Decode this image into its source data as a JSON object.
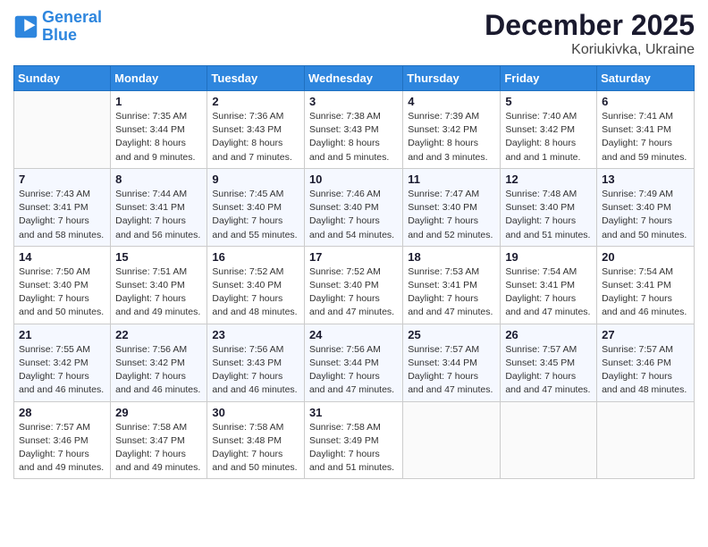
{
  "logo": {
    "line1": "General",
    "line2": "Blue"
  },
  "title": "December 2025",
  "location": "Koriukivka, Ukraine",
  "weekdays": [
    "Sunday",
    "Monday",
    "Tuesday",
    "Wednesday",
    "Thursday",
    "Friday",
    "Saturday"
  ],
  "weeks": [
    [
      {
        "day": "",
        "sunrise": "",
        "sunset": "",
        "daylight": ""
      },
      {
        "day": "1",
        "sunrise": "Sunrise: 7:35 AM",
        "sunset": "Sunset: 3:44 PM",
        "daylight": "Daylight: 8 hours and 9 minutes."
      },
      {
        "day": "2",
        "sunrise": "Sunrise: 7:36 AM",
        "sunset": "Sunset: 3:43 PM",
        "daylight": "Daylight: 8 hours and 7 minutes."
      },
      {
        "day": "3",
        "sunrise": "Sunrise: 7:38 AM",
        "sunset": "Sunset: 3:43 PM",
        "daylight": "Daylight: 8 hours and 5 minutes."
      },
      {
        "day": "4",
        "sunrise": "Sunrise: 7:39 AM",
        "sunset": "Sunset: 3:42 PM",
        "daylight": "Daylight: 8 hours and 3 minutes."
      },
      {
        "day": "5",
        "sunrise": "Sunrise: 7:40 AM",
        "sunset": "Sunset: 3:42 PM",
        "daylight": "Daylight: 8 hours and 1 minute."
      },
      {
        "day": "6",
        "sunrise": "Sunrise: 7:41 AM",
        "sunset": "Sunset: 3:41 PM",
        "daylight": "Daylight: 7 hours and 59 minutes."
      }
    ],
    [
      {
        "day": "7",
        "sunrise": "Sunrise: 7:43 AM",
        "sunset": "Sunset: 3:41 PM",
        "daylight": "Daylight: 7 hours and 58 minutes."
      },
      {
        "day": "8",
        "sunrise": "Sunrise: 7:44 AM",
        "sunset": "Sunset: 3:41 PM",
        "daylight": "Daylight: 7 hours and 56 minutes."
      },
      {
        "day": "9",
        "sunrise": "Sunrise: 7:45 AM",
        "sunset": "Sunset: 3:40 PM",
        "daylight": "Daylight: 7 hours and 55 minutes."
      },
      {
        "day": "10",
        "sunrise": "Sunrise: 7:46 AM",
        "sunset": "Sunset: 3:40 PM",
        "daylight": "Daylight: 7 hours and 54 minutes."
      },
      {
        "day": "11",
        "sunrise": "Sunrise: 7:47 AM",
        "sunset": "Sunset: 3:40 PM",
        "daylight": "Daylight: 7 hours and 52 minutes."
      },
      {
        "day": "12",
        "sunrise": "Sunrise: 7:48 AM",
        "sunset": "Sunset: 3:40 PM",
        "daylight": "Daylight: 7 hours and 51 minutes."
      },
      {
        "day": "13",
        "sunrise": "Sunrise: 7:49 AM",
        "sunset": "Sunset: 3:40 PM",
        "daylight": "Daylight: 7 hours and 50 minutes."
      }
    ],
    [
      {
        "day": "14",
        "sunrise": "Sunrise: 7:50 AM",
        "sunset": "Sunset: 3:40 PM",
        "daylight": "Daylight: 7 hours and 50 minutes."
      },
      {
        "day": "15",
        "sunrise": "Sunrise: 7:51 AM",
        "sunset": "Sunset: 3:40 PM",
        "daylight": "Daylight: 7 hours and 49 minutes."
      },
      {
        "day": "16",
        "sunrise": "Sunrise: 7:52 AM",
        "sunset": "Sunset: 3:40 PM",
        "daylight": "Daylight: 7 hours and 48 minutes."
      },
      {
        "day": "17",
        "sunrise": "Sunrise: 7:52 AM",
        "sunset": "Sunset: 3:40 PM",
        "daylight": "Daylight: 7 hours and 47 minutes."
      },
      {
        "day": "18",
        "sunrise": "Sunrise: 7:53 AM",
        "sunset": "Sunset: 3:41 PM",
        "daylight": "Daylight: 7 hours and 47 minutes."
      },
      {
        "day": "19",
        "sunrise": "Sunrise: 7:54 AM",
        "sunset": "Sunset: 3:41 PM",
        "daylight": "Daylight: 7 hours and 47 minutes."
      },
      {
        "day": "20",
        "sunrise": "Sunrise: 7:54 AM",
        "sunset": "Sunset: 3:41 PM",
        "daylight": "Daylight: 7 hours and 46 minutes."
      }
    ],
    [
      {
        "day": "21",
        "sunrise": "Sunrise: 7:55 AM",
        "sunset": "Sunset: 3:42 PM",
        "daylight": "Daylight: 7 hours and 46 minutes."
      },
      {
        "day": "22",
        "sunrise": "Sunrise: 7:56 AM",
        "sunset": "Sunset: 3:42 PM",
        "daylight": "Daylight: 7 hours and 46 minutes."
      },
      {
        "day": "23",
        "sunrise": "Sunrise: 7:56 AM",
        "sunset": "Sunset: 3:43 PM",
        "daylight": "Daylight: 7 hours and 46 minutes."
      },
      {
        "day": "24",
        "sunrise": "Sunrise: 7:56 AM",
        "sunset": "Sunset: 3:44 PM",
        "daylight": "Daylight: 7 hours and 47 minutes."
      },
      {
        "day": "25",
        "sunrise": "Sunrise: 7:57 AM",
        "sunset": "Sunset: 3:44 PM",
        "daylight": "Daylight: 7 hours and 47 minutes."
      },
      {
        "day": "26",
        "sunrise": "Sunrise: 7:57 AM",
        "sunset": "Sunset: 3:45 PM",
        "daylight": "Daylight: 7 hours and 47 minutes."
      },
      {
        "day": "27",
        "sunrise": "Sunrise: 7:57 AM",
        "sunset": "Sunset: 3:46 PM",
        "daylight": "Daylight: 7 hours and 48 minutes."
      }
    ],
    [
      {
        "day": "28",
        "sunrise": "Sunrise: 7:57 AM",
        "sunset": "Sunset: 3:46 PM",
        "daylight": "Daylight: 7 hours and 49 minutes."
      },
      {
        "day": "29",
        "sunrise": "Sunrise: 7:58 AM",
        "sunset": "Sunset: 3:47 PM",
        "daylight": "Daylight: 7 hours and 49 minutes."
      },
      {
        "day": "30",
        "sunrise": "Sunrise: 7:58 AM",
        "sunset": "Sunset: 3:48 PM",
        "daylight": "Daylight: 7 hours and 50 minutes."
      },
      {
        "day": "31",
        "sunrise": "Sunrise: 7:58 AM",
        "sunset": "Sunset: 3:49 PM",
        "daylight": "Daylight: 7 hours and 51 minutes."
      },
      {
        "day": "",
        "sunrise": "",
        "sunset": "",
        "daylight": ""
      },
      {
        "day": "",
        "sunrise": "",
        "sunset": "",
        "daylight": ""
      },
      {
        "day": "",
        "sunrise": "",
        "sunset": "",
        "daylight": ""
      }
    ]
  ]
}
